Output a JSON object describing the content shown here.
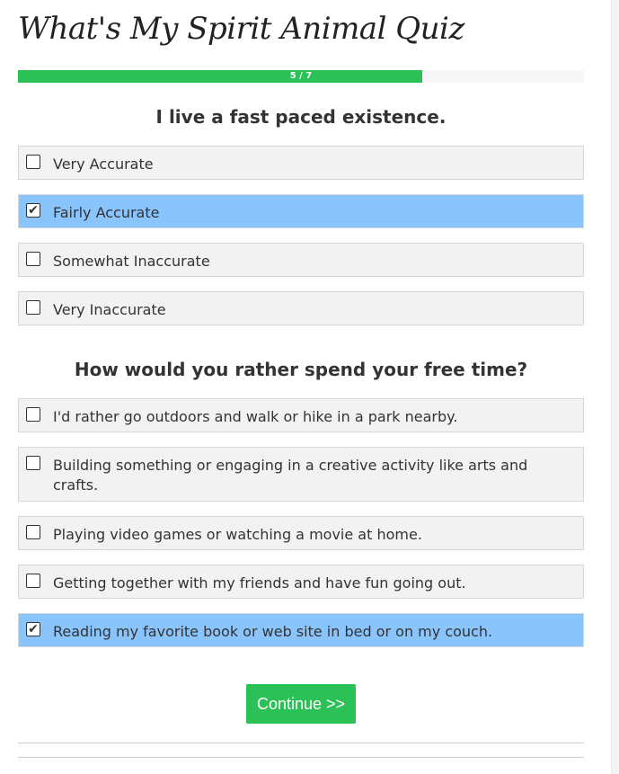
{
  "title": "What's My Spirit Animal Quiz",
  "progress": {
    "label": "5 / 7",
    "current": 5,
    "total": 7
  },
  "questions": [
    {
      "text": "I live a fast paced existence.",
      "options": [
        {
          "label": "Very Accurate",
          "checked": false
        },
        {
          "label": "Fairly Accurate",
          "checked": true
        },
        {
          "label": "Somewhat Inaccurate",
          "checked": false
        },
        {
          "label": "Very Inaccurate",
          "checked": false
        }
      ]
    },
    {
      "text": "How would you rather spend your free time?",
      "options": [
        {
          "label": "I'd rather go outdoors and walk or hike in a park nearby.",
          "checked": false
        },
        {
          "label": "Building something or engaging in a creative activity like arts and crafts.",
          "checked": false
        },
        {
          "label": "Playing video games or watching a movie at home.",
          "checked": false
        },
        {
          "label": "Getting together with my friends and have fun going out.",
          "checked": false
        },
        {
          "label": "Reading my favorite book or web site in bed or on my couch.",
          "checked": true
        }
      ]
    }
  ],
  "continue_label": "Continue >>",
  "colors": {
    "accent": "#2bc157",
    "selected": "#89c4fd",
    "option_bg": "#f2f2f2"
  }
}
